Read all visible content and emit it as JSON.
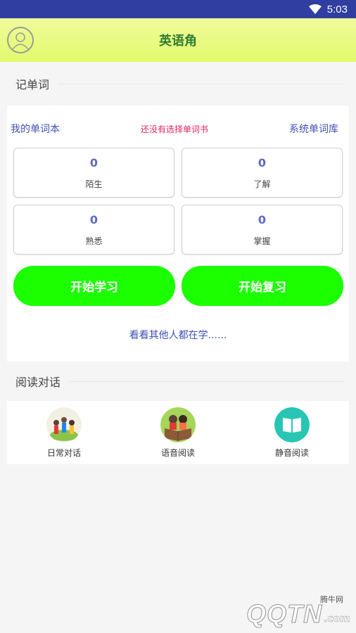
{
  "status_bar": {
    "time": "5:03"
  },
  "app_bar": {
    "title": "英语角"
  },
  "words_section": {
    "title": "记单词",
    "my_wordbook": "我的单词本",
    "no_book_hint": "还没有选择单词书",
    "system_wordbook": "系统单词库",
    "stats": [
      {
        "value": "0",
        "label": "陌生"
      },
      {
        "value": "0",
        "label": "了解"
      },
      {
        "value": "0",
        "label": "熟悉"
      },
      {
        "value": "0",
        "label": "掌握"
      }
    ],
    "start_learning": "开始学习",
    "start_review": "开始复习",
    "see_others": "看看其他人都在学......"
  },
  "reading_section": {
    "title": "阅读对话",
    "items": [
      {
        "label": "日常对话",
        "icon": "daily-conversation-icon"
      },
      {
        "label": "语音阅读",
        "icon": "voice-reading-icon"
      },
      {
        "label": "静音阅读",
        "icon": "silent-reading-icon"
      }
    ]
  },
  "watermark": {
    "brand": "QQTN",
    "suffix": ".com",
    "tag": "腾牛网"
  },
  "colors": {
    "status_bar": "#2f3ea0",
    "app_bar": "#e2fa6b",
    "accent_green": "#1bff00",
    "link_blue": "#3f51b5",
    "hint_red": "#e0245e"
  }
}
